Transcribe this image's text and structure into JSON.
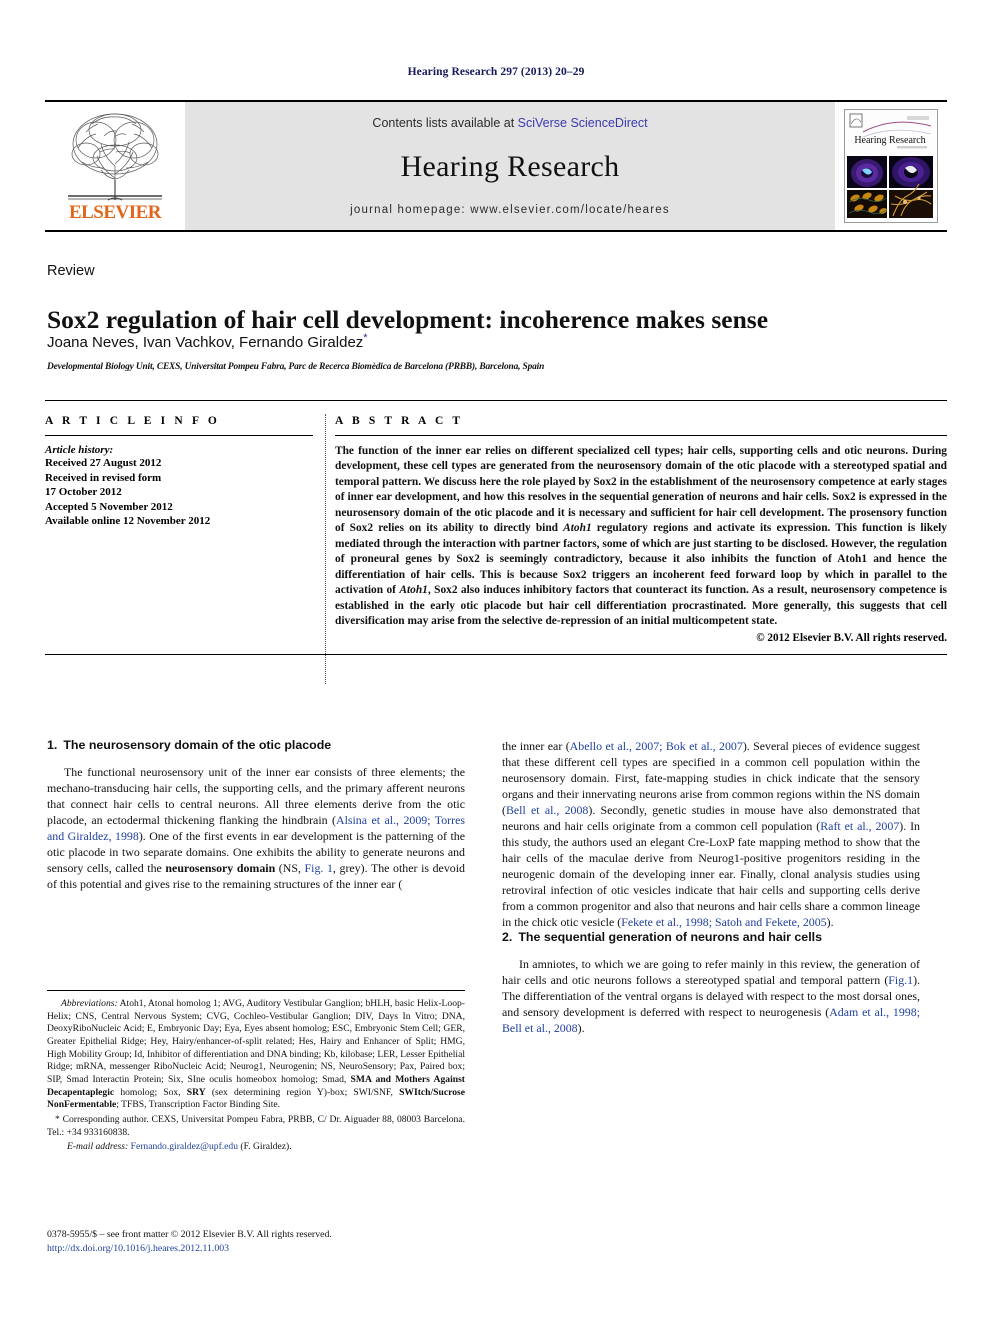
{
  "running_head": "Hearing Research 297 (2013) 20–29",
  "masthead": {
    "publisher": "ELSEVIER",
    "contents_prefix": "Contents lists available at ",
    "contents_link": "SciVerse ScienceDirect",
    "journal_name": "Hearing Research",
    "homepage": "journal homepage: www.elsevier.com/locate/heares",
    "cover_title": "Hearing Research",
    "link_color": "#3a3ab0",
    "elsevier_orange": "#e2661a"
  },
  "article": {
    "doctype": "Review",
    "title": "Sox2 regulation of hair cell development: incoherence makes sense",
    "authors": "Joana Neves, Ivan Vachkov, Fernando Giraldez",
    "corresponding_marker": "*",
    "affiliation": "Developmental Biology Unit, CEXS, Universitat Pompeu Fabra, Parc de Recerca Biomèdica de Barcelona (PRBB), Barcelona, Spain"
  },
  "article_info": {
    "heading": "A R T I C L E   I N F O",
    "history_label": "Article history:",
    "history": [
      "Received 27 August 2012",
      "Received in revised form",
      "17 October 2012",
      "Accepted 5 November 2012",
      "Available online 12 November 2012"
    ]
  },
  "abstract": {
    "heading": "A B S T R A C T",
    "text_part_1": "The function of the inner ear relies on different specialized cell types; hair cells, supporting cells and otic neurons. During development, these cell types are generated from the neurosensory domain of the otic placode with a stereotyped spatial and temporal pattern. We discuss here the role played by Sox2 in the establishment of the neurosensory competence at early stages of inner ear development, and how this resolves in the sequential generation of neurons and hair cells. Sox2 is expressed in the neurosensory domain of the otic placode and it is necessary and sufficient for hair cell development. The prosensory function of Sox2 relies on its ability to directly bind ",
    "italic_1": "Atoh1",
    "text_part_2": " regulatory regions and activate its expression. This function is likely mediated through the interaction with partner factors, some of which are just starting to be disclosed. However, the regulation of proneural genes by Sox2 is seemingly contradictory, because it also inhibits the function of Atoh1 and hence the differentiation of hair cells. This is because Sox2 triggers an incoherent feed forward loop by which in parallel to the activation of ",
    "italic_2": "Atoh1",
    "text_part_3": ", Sox2 also induces inhibitory factors that counteract its function. As a result, neurosensory competence is established in the early otic placode but hair cell differentiation procrastinated. More generally, this suggests that cell diversification may arise from the selective de-repression of an initial multicompetent state.",
    "copyright": "© 2012 Elsevier B.V. All rights reserved."
  },
  "sections": {
    "s1": {
      "number": "1.",
      "title": "The neurosensory domain of the otic placode",
      "p1_a": "The functional neurosensory unit of the inner ear consists of three elements; the mechano-transducing hair cells, the supporting cells, and the primary afferent neurons that connect hair cells to central neurons. All three elements derive from the otic placode, an ectodermal thickening flanking the hindbrain (",
      "p1_ref1": "Alsina et al., 2009; Torres and Giraldez, 1998",
      "p1_b": "). One of the first events in ear development is the patterning of the otic placode in two separate domains. One exhibits the ability to generate neurons and sensory cells, called the ",
      "p1_bold": "neurosensory domain",
      "p1_c": " (NS, ",
      "p1_ref2": "Fig. 1",
      "p1_d": ", grey). The other is devoid of this potential and gives rise to the remaining structures of the inner ear (",
      "p1_ref3": "Abello et al., 2007; Bok et al., 2007",
      "p1_e": "). Several pieces of evidence suggest that these different cell types are specified in a common cell population within the neurosensory domain. First, fate-mapping studies in chick indicate that the sensory organs and their innervating neurons arise from common regions within the NS domain (",
      "p1_ref4": "Bell et al., 2008",
      "p1_f": "). Secondly, genetic studies in mouse have also demonstrated that neurons and hair cells originate from a common cell population (",
      "p1_ref5": "Raft et al., 2007",
      "p1_g": "). In this study, the authors used an elegant Cre-LoxP fate mapping method to show that the hair cells of the maculae derive from Neurog1-positive progenitors residing in the neurogenic domain of the developing inner ear. Finally, clonal analysis studies using retroviral infection of otic vesicles indicate that hair cells and supporting cells derive from a common progenitor and also that neurons and hair cells share a common lineage in the chick otic vesicle (",
      "p1_ref6": "Fekete et al., 1998; Satoh and Fekete, 2005",
      "p1_h": ")."
    },
    "s2": {
      "number": "2.",
      "title": "The sequential generation of neurons and hair cells",
      "p1_a": "In amniotes, to which we are going to refer mainly in this review, the generation of hair cells and otic neurons follows a stereotyped spatial and temporal pattern (",
      "p1_ref1": "Fig.1",
      "p1_b": "). The differentiation of the ventral organs is delayed with respect to the most dorsal ones, and sensory development is deferred with respect to neurogenesis (",
      "p1_ref2": "Adam et al., 1998; Bell et al., 2008",
      "p1_c": ")."
    }
  },
  "footnotes": {
    "abbrev_label": "Abbreviations:",
    "abbrev_text": " Atoh1, Atonal homolog 1; AVG, Auditory Vestibular Ganglion; bHLH, basic Helix-Loop-Helix; CNS, Central Nervous System; CVG, Cochleo-Vestibular Ganglion; DIV, Days In Vitro; DNA, DeoxyRiboNucleic Acid; E, Embryonic Day; Eya, Eyes absent homolog; ESC, Embryonic Stem Cell; GER, Greater Epithelial Ridge; Hey, Hairy/enhancer-of-split related; Hes, Hairy and Enhancer of Split; HMG, High Mobility Group; Id, Inhibitor of differentiation and DNA binding; Kb, kilobase; LER, Lesser Epithelial Ridge; mRNA, messenger RiboNucleic Acid; Neurog1, Neurogenin; NS, NeuroSensory; Pax, Paired box; SIP, Smad Interactin Protein; Six, SIne oculis homeobox homolog; Smad, ",
    "abbrev_bold": "SMA and Mothers Against Decapentaplegic",
    "abbrev_text_2": " homolog; Sox, ",
    "abbrev_bold_2": "SRY",
    "abbrev_text_3": " (sex determining region Y)-box; SWI/SNF, ",
    "abbrev_bold_3": "SWItch/Sucrose NonFermentable",
    "abbrev_text_4": "; TFBS, Transcription Factor Binding Site.",
    "corresponding": "* Corresponding author. CEXS, Universitat Pompeu Fabra, PRBB, C/ Dr. Aiguader 88, 08003 Barcelona. Tel.: +34 933160838.",
    "email_label": "E-mail address:",
    "email": "Fernando.giraldez@upf.edu",
    "email_suffix": " (F. Giraldez)."
  },
  "imprint": {
    "line1": "0378-5955/$ – see front matter © 2012 Elsevier B.V. All rights reserved.",
    "doi": "http://dx.doi.org/10.1016/j.heares.2012.11.003"
  }
}
